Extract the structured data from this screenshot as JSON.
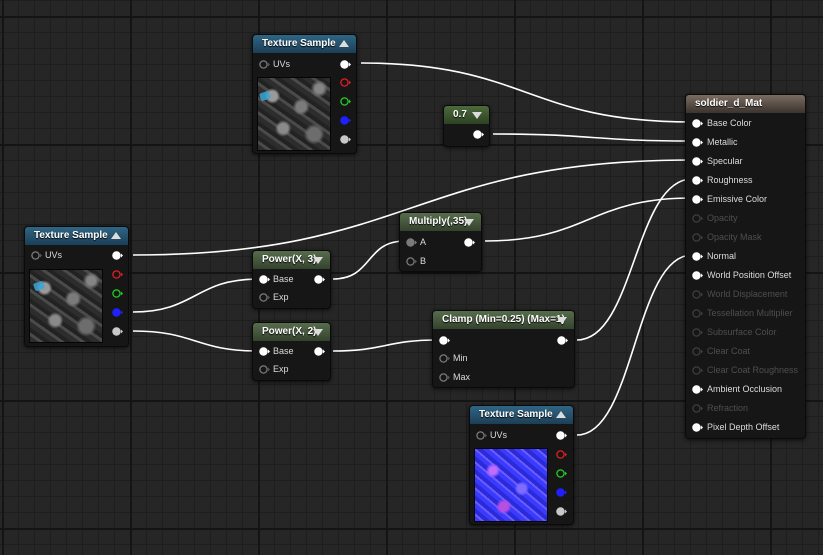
{
  "graph": {
    "nodes": {
      "tex1": {
        "title": "Texture Sample",
        "uvs_label": "UVs"
      },
      "tex2": {
        "title": "Texture Sample",
        "uvs_label": "UVs"
      },
      "tex3": {
        "title": "Texture Sample",
        "uvs_label": "UVs"
      },
      "const": {
        "title": "0.7"
      },
      "power3": {
        "title": "Power(X, 3)",
        "base_label": "Base",
        "exp_label": "Exp"
      },
      "power2": {
        "title": "Power(X, 2)",
        "base_label": "Base",
        "exp_label": "Exp"
      },
      "multiply": {
        "title": "Multiply(,35)",
        "a_label": "A",
        "b_label": "B"
      },
      "clamp": {
        "title": "Clamp (Min=0.25) (Max=1)",
        "min_label": "Min",
        "max_label": "Max"
      }
    },
    "material": {
      "title": "soldier_d_Mat",
      "inputs": [
        {
          "label": "Base Color",
          "enabled": true
        },
        {
          "label": "Metallic",
          "enabled": true
        },
        {
          "label": "Specular",
          "enabled": true
        },
        {
          "label": "Roughness",
          "enabled": true
        },
        {
          "label": "Emissive Color",
          "enabled": true
        },
        {
          "label": "Opacity",
          "enabled": false
        },
        {
          "label": "Opacity Mask",
          "enabled": false
        },
        {
          "label": "Normal",
          "enabled": true
        },
        {
          "label": "World Position Offset",
          "enabled": true
        },
        {
          "label": "World Displacement",
          "enabled": false
        },
        {
          "label": "Tessellation Multiplier",
          "enabled": false
        },
        {
          "label": "Subsurface Color",
          "enabled": false
        },
        {
          "label": "Clear Coat",
          "enabled": false
        },
        {
          "label": "Clear Coat Roughness",
          "enabled": false
        },
        {
          "label": "Ambient Occlusion",
          "enabled": true
        },
        {
          "label": "Refraction",
          "enabled": false
        },
        {
          "label": "Pixel Depth Offset",
          "enabled": true
        }
      ]
    },
    "pin_colors": {
      "white": "#ffffff",
      "red": "#e02020",
      "green": "#20d020",
      "blue": "#2020ff",
      "alpha": "#c8c8c8",
      "wire": "#ffffff"
    }
  }
}
